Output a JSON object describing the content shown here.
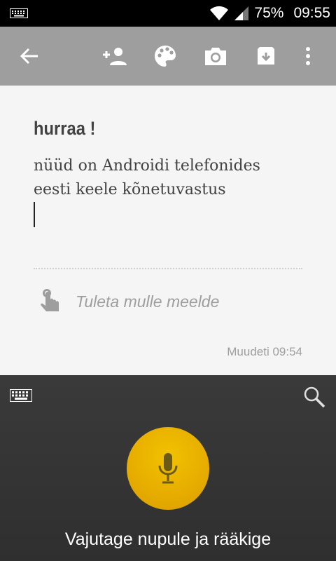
{
  "status_bar": {
    "battery": "75%",
    "time": "09:55",
    "icons": [
      "keyboard-icon",
      "wifi-icon",
      "signal-icon"
    ]
  },
  "toolbar": {
    "icons": [
      "back-arrow-icon",
      "add-person-icon",
      "palette-icon",
      "camera-icon",
      "archive-icon",
      "overflow-menu-icon"
    ],
    "background": "#9e9e9e"
  },
  "note": {
    "title": "hurraa !",
    "body_lines": [
      "nüüd on Androidi telefonides",
      "eesti keele kõnetuvastus"
    ],
    "reminder_placeholder": "Tuleta mulle meelde",
    "modified": "Muudeti 09:54"
  },
  "voice_input": {
    "prompt": "Vajutage nupule ja rääkige",
    "mic_color": "#f0b800",
    "icons": [
      "keyboard-icon",
      "search-icon",
      "microphone-icon"
    ]
  }
}
